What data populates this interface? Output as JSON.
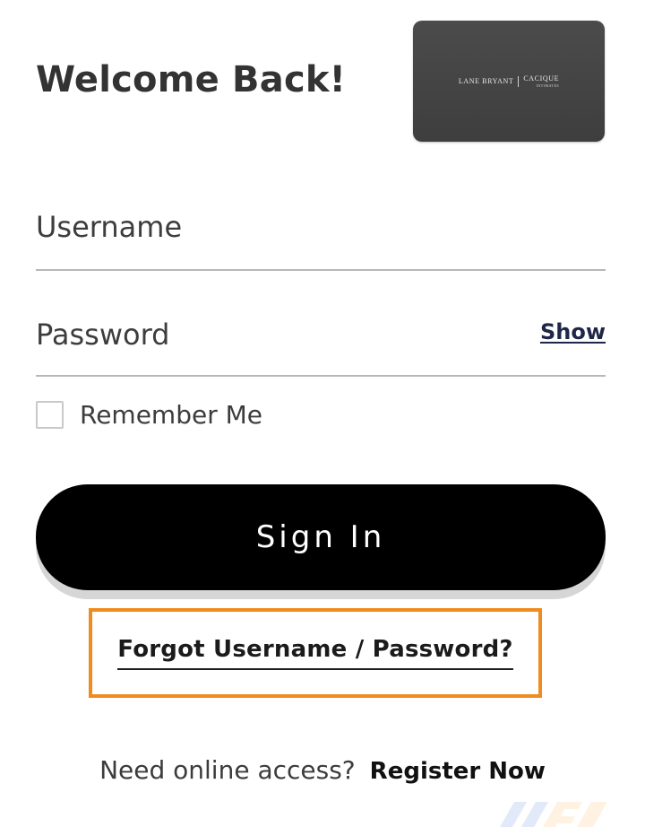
{
  "header": {
    "title": "Welcome Back!"
  },
  "logo": {
    "brand_left": "LANE BRYANT",
    "brand_right": "CACIQUE",
    "brand_sub": "INTIMATES"
  },
  "form": {
    "username_placeholder": "Username",
    "password_placeholder": "Password",
    "show_label": "Show",
    "remember_label": "Remember Me",
    "signin_label": "Sign In"
  },
  "links": {
    "forgot_label": "Forgot Username / Password?",
    "need_access_label": "Need online access?",
    "register_label": "Register Now"
  },
  "colors": {
    "highlight_border": "#f08c1f",
    "button_bg": "#000000",
    "show_link": "#1f2748"
  }
}
